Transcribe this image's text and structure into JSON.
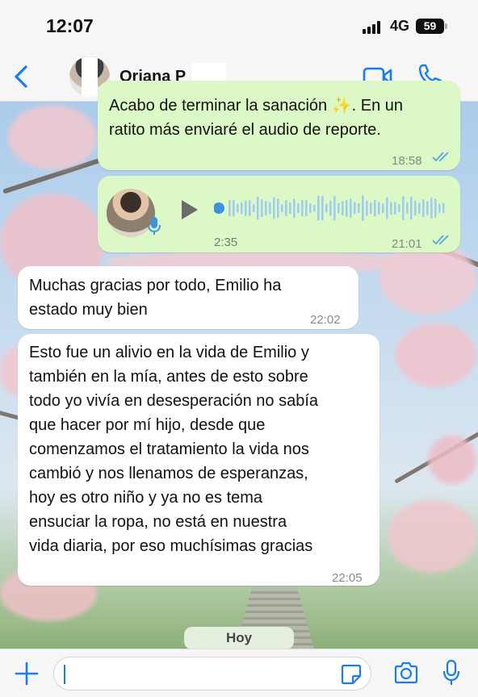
{
  "status_bar": {
    "time": "12:07",
    "network": "4G",
    "battery": "59"
  },
  "header": {
    "contact_name": "Oriana P",
    "back_icon": "chevron-left-icon",
    "video_icon": "video-camera-icon",
    "call_icon": "phone-icon",
    "accent_color": "#1a7cf3"
  },
  "messages": [
    {
      "direction": "outgoing",
      "text_line1": "Acabo de terminar la sanación ✨. En un",
      "text_line2": "ratito más enviaré el audio de reporte.",
      "time": "18:58",
      "status": "read"
    },
    {
      "direction": "outgoing",
      "type": "voice",
      "duration": "2:35",
      "time": "21:01",
      "status": "read"
    },
    {
      "direction": "incoming",
      "lines": [
        "Muchas gracias por todo, Emilio ha",
        "estado muy bien"
      ],
      "time": "22:02"
    },
    {
      "direction": "incoming",
      "lines": [
        "Esto fue un alivio en la vida de Emilio y",
        "también en la mía, antes de esto sobre",
        "todo yo vivía en desesperación no sabía",
        "que hacer por mí hijo, desde que",
        "comenzamos el tratamiento la vida nos",
        "cambió y nos llenamos de esperanzas,",
        "hoy es otro niño y ya no es tema",
        "ensuciar la ropa, no está en nuestra",
        "vida diaria, por eso muchísimas gracias"
      ],
      "time": "22:05"
    }
  ],
  "date_chip": "Hoy",
  "composer": {
    "text": "",
    "icons": [
      "plus-icon",
      "sticker-icon",
      "camera-icon",
      "microphone-icon"
    ]
  },
  "colors": {
    "outgoing_bubble": "#dcf8c6",
    "incoming_bubble": "#ffffff",
    "read_ticks": "#53a6e6"
  }
}
